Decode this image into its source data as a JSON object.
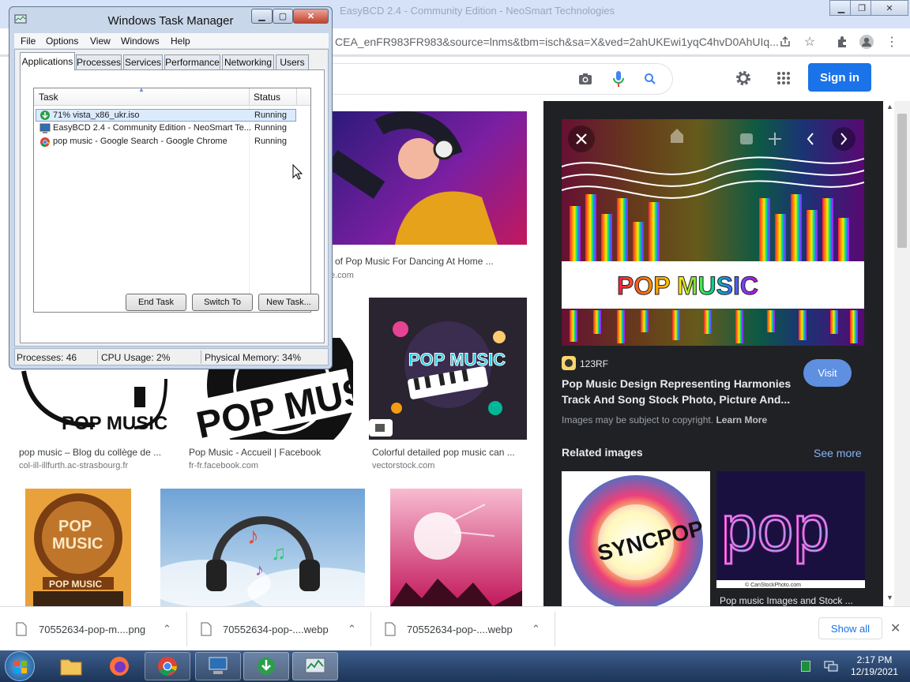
{
  "browser": {
    "tab_title": "EasyBCD 2.4 - Community Edition - NeoSmart Technologies",
    "url_visible": "CEA_enFR983FR983&source=lnms&tbm=isch&sa=X&ved=2ahUKEwi1yqC4hvD0AhUIq..."
  },
  "google": {
    "signin_label": "Sign in"
  },
  "results": [
    {
      "caption": "of Pop Music For Dancing At Home ...",
      "source": "e.com"
    },
    {
      "caption": "pop music – Blog du collège de ...",
      "source": "col-ill-illfurth.ac-strasbourg.fr"
    },
    {
      "caption": "Pop Music - Accueil | Facebook",
      "source": "fr-fr.facebook.com"
    },
    {
      "caption": "Colorful detailed pop music can ...",
      "source": "vectorstock.com"
    }
  ],
  "thumb_text": {
    "pop_music_fb_text": "POP MUSIC",
    "pop_music_blog_text": "POP MUSIC",
    "vector_text": "POP MUSIC",
    "badge_pop": "POP",
    "badge_music": "MUSIC",
    "badge_ribbon": "POP MUSIC"
  },
  "panel": {
    "image_text": "POP MUSIC",
    "source_name": "123RF",
    "visit_label": "Visit",
    "title": "Pop Music Design Representing Harmonies Track And Song Stock Photo, Picture And...",
    "copyright": "Images may be subject to copyright.",
    "learn_more": "Learn More",
    "related_label": "Related images",
    "see_more": "See more",
    "related": [
      {
        "text": "SYNCPOP"
      },
      {
        "text": "pop",
        "caption": "Pop music Images and Stock ...",
        "watermark": "© CanStockPhoto.com"
      }
    ]
  },
  "downloads": {
    "items": [
      {
        "name": "70552634-pop-m....png"
      },
      {
        "name": "70552634-pop-....webp"
      },
      {
        "name": "70552634-pop-....webp"
      }
    ],
    "show_all": "Show all"
  },
  "taskbar": {
    "time": "2:17 PM",
    "date": "12/19/2021"
  },
  "task_manager": {
    "title": "Windows Task Manager",
    "menu": [
      "File",
      "Options",
      "View",
      "Windows",
      "Help"
    ],
    "tabs": [
      "Applications",
      "Processes",
      "Services",
      "Performance",
      "Networking",
      "Users"
    ],
    "columns": {
      "task": "Task",
      "status": "Status"
    },
    "tasks": [
      {
        "name": "71% vista_x86_ukr.iso",
        "status": "Running"
      },
      {
        "name": "EasyBCD 2.4 - Community Edition - NeoSmart Te...",
        "status": "Running"
      },
      {
        "name": "pop music - Google Search - Google Chrome",
        "status": "Running"
      }
    ],
    "buttons": {
      "end_task": "End Task",
      "switch_to": "Switch To",
      "new_task": "New Task..."
    },
    "status": {
      "processes": "Processes: 46",
      "cpu": "CPU Usage: 2%",
      "memory": "Physical Memory: 34%"
    }
  },
  "colors": {
    "accent": "#1a73e8",
    "panel_bg": "#202124"
  }
}
